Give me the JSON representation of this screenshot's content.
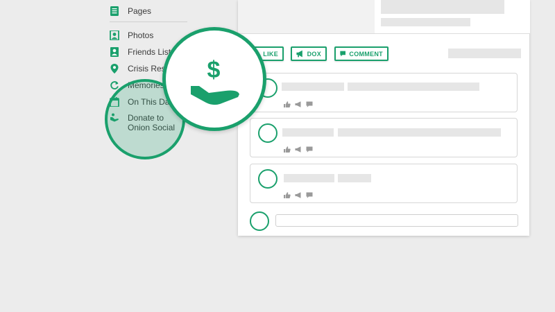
{
  "sidebar": {
    "items": [
      {
        "label": "Pages",
        "icon": "pages-icon"
      },
      {
        "label": "Photos",
        "icon": "photos-icon"
      },
      {
        "label": "Friends List",
        "icon": "friends-list-icon"
      },
      {
        "label": "Crisis Resp",
        "icon": "location-pin-icon"
      },
      {
        "label": "Memories",
        "icon": "refresh-icon"
      },
      {
        "label": "On This Day",
        "icon": "calendar-icon"
      },
      {
        "label": "Donate to Onion Social",
        "icon": "donate-hand-icon"
      }
    ]
  },
  "magnifier": {
    "icon": "donate-hand-dollar-icon",
    "symbol": "$"
  },
  "actions": {
    "like_label": "LIKE",
    "dox_label": "DOX",
    "comment_label": "COMMENT"
  },
  "colors": {
    "accent": "#1aa06c",
    "background": "#ececec",
    "placeholder": "#e6e6e6"
  }
}
